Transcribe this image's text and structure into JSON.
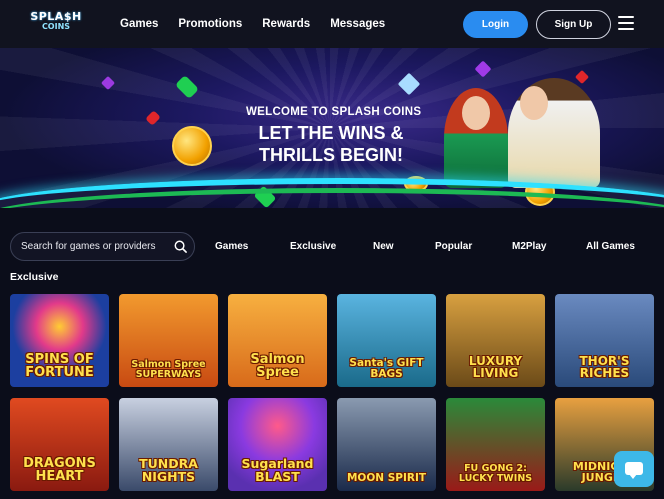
{
  "header": {
    "logo_line1": "SPLA$H",
    "logo_line2": "COINS",
    "nav": [
      "Games",
      "Promotions",
      "Rewards",
      "Messages"
    ],
    "login_label": "Login",
    "signup_label": "Sign Up"
  },
  "hero": {
    "welcome": "WELCOME TO SPLASH COINS",
    "headline_line1": "LET THE WINS &",
    "headline_line2": "THRILLS BEGIN!"
  },
  "search": {
    "placeholder": "Search for games or providers"
  },
  "tabs": [
    "Games",
    "Exclusive",
    "New",
    "Popular",
    "M2Play",
    "All Games"
  ],
  "section_title": "Exclusive",
  "games": [
    {
      "title": "SPINS OF FORTUNE",
      "bg": "#1c3fa0"
    },
    {
      "title": "Salmon Spree SUPERWAYS",
      "bg": "#c84a12"
    },
    {
      "title": "Salmon Spree",
      "bg": "#d86a1a"
    },
    {
      "title": "Santa's GIFT BAGS",
      "bg": "#1a6a8a"
    },
    {
      "title": "LUXURY LIVING",
      "bg": "#6b4a18"
    },
    {
      "title": "THOR'S RICHES",
      "bg": "#2a4a7a"
    },
    {
      "title": "DRAGONS HEART",
      "bg": "#8a1a10"
    },
    {
      "title": "TUNDRA NIGHTS",
      "bg": "#3a4a6a"
    },
    {
      "title": "Sugarland BLAST",
      "bg": "#5a30b0"
    },
    {
      "title": "MOON SPIRIT",
      "bg": "#1a2a4a"
    },
    {
      "title": "FU GONG 2: LUCKY TWINS",
      "bg": "#9a1a18"
    },
    {
      "title": "MIDNIGHT JUNGLE",
      "bg": "#2a3a2a"
    }
  ],
  "icons": {
    "search": "search-icon",
    "menu": "hamburger-menu-icon",
    "chat": "chat-icon"
  },
  "colors": {
    "accent": "#2a8cf0",
    "header_bg": "#11131f",
    "page_bg": "#0b0d1a",
    "chat": "#3db8e8"
  }
}
